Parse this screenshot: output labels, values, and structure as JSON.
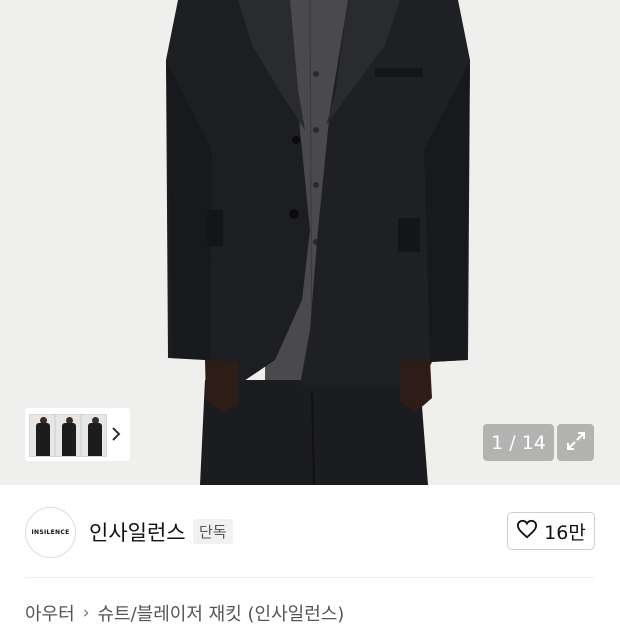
{
  "gallery": {
    "counter": "1 / 14",
    "thumbnail_count": 3
  },
  "brand": {
    "logo_text": "INSILENCE",
    "name": "인사일런스",
    "badge": "단독"
  },
  "like": {
    "count": "16만",
    "icon": "heart-outline-icon"
  },
  "breadcrumb": {
    "items": [
      "아우터",
      "슈트/블레이저 재킷 (인사일런스)"
    ],
    "separator": "›"
  },
  "icons": {
    "thumb_next": "chevron-right-icon",
    "expand": "expand-arrows-icon"
  },
  "colors": {
    "jacket": "#1d1e21",
    "shirt": "#4a4a4c",
    "background": "#efefed"
  }
}
